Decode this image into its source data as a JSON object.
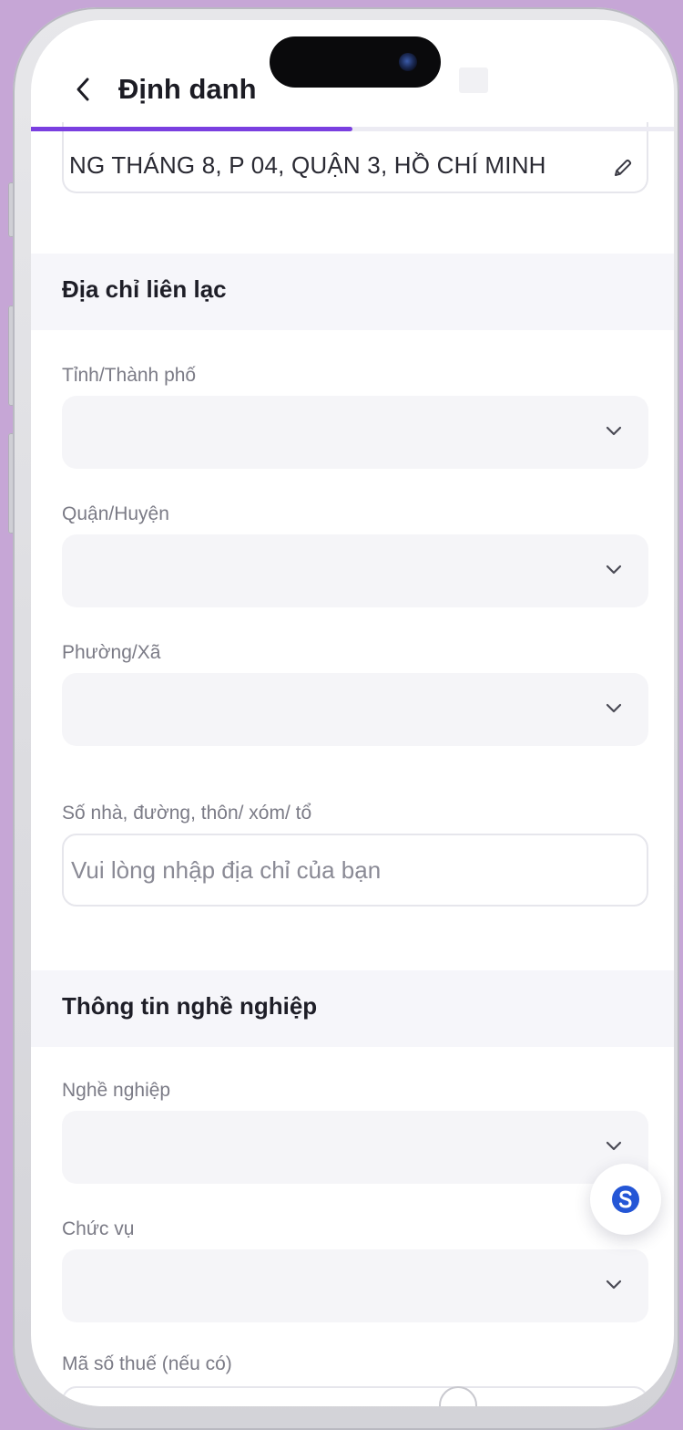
{
  "header": {
    "back_icon": "chevron-left-icon",
    "title": "Định danh"
  },
  "progress": {
    "value": 0.5,
    "color": "#7a3fe0"
  },
  "permanent_address": {
    "value": "NG THÁNG 8, P 04, QUẬN 3, HỒ CHÍ MINH",
    "edit_icon": "pencil-icon"
  },
  "contact_address": {
    "section_title": "Địa chỉ liên lạc",
    "province_label": "Tỉnh/Thành phố",
    "district_label": "Quận/Huyện",
    "ward_label": "Phường/Xã",
    "street_label": "Số nhà, đường, thôn/ xóm/ tổ",
    "street_placeholder": "Vui lòng nhập địa chỉ của bạn"
  },
  "occupation": {
    "section_title": "Thông tin nghề nghiệp",
    "job_label": "Nghề nghiệp",
    "position_label": "Chức vụ",
    "tax_label": "Mã số thuế (nếu có)"
  },
  "icons": {
    "dropdown": "chevron-down-icon",
    "support": "support-chat-icon"
  },
  "colors": {
    "accent": "#7a3fe0",
    "support_icon": "#2456d6",
    "background": "#c6a6d6"
  }
}
